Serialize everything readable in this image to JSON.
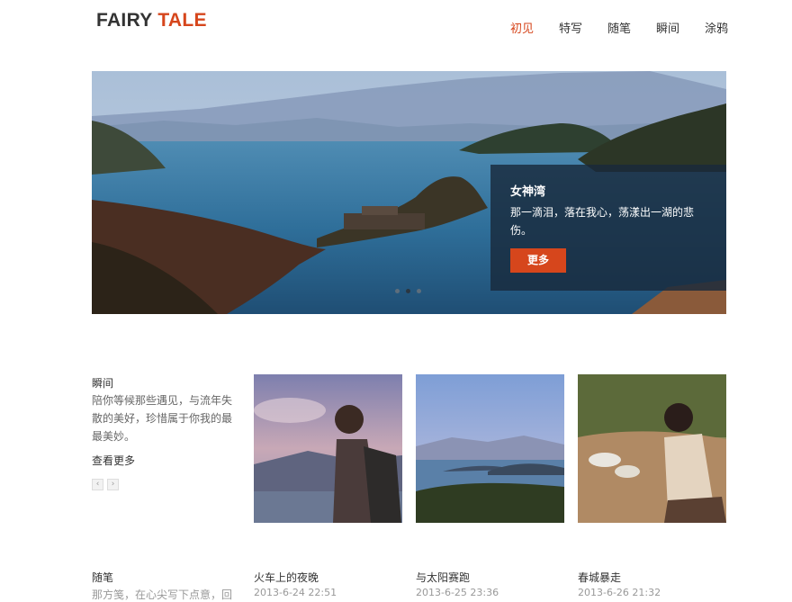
{
  "brand": {
    "part1": "FAIRY",
    "part2": "TALE"
  },
  "nav": [
    {
      "label": "初见",
      "active": true
    },
    {
      "label": "特写"
    },
    {
      "label": "随笔"
    },
    {
      "label": "瞬间"
    },
    {
      "label": "涂鸦"
    }
  ],
  "hero": {
    "title": "女神湾",
    "text": "那一滴泪，落在我心，荡漾出一湖的悲伤。",
    "button": "更多",
    "slides": 3,
    "active_slide": 2
  },
  "moments": {
    "title": "瞬间",
    "text": "陪你等候那些遇见，与流年失散的美好，珍惜属于你我的最最美妙。",
    "more": "查看更多",
    "prev": "‹",
    "next": "›"
  },
  "essays": {
    "title": "随笔",
    "text": "那方笺，在心尖写下点意，回"
  },
  "posts": [
    {
      "title": "火车上的夜晚",
      "date": "2013-6-24 22:51"
    },
    {
      "title": "与太阳赛跑",
      "date": "2013-6-25 23:36"
    },
    {
      "title": "春城暴走",
      "date": "2013-6-26 21:32"
    }
  ],
  "colors": {
    "accent": "#d6461c",
    "text": "#333333",
    "muted": "#999999",
    "caption_bg": "#192a3c"
  }
}
